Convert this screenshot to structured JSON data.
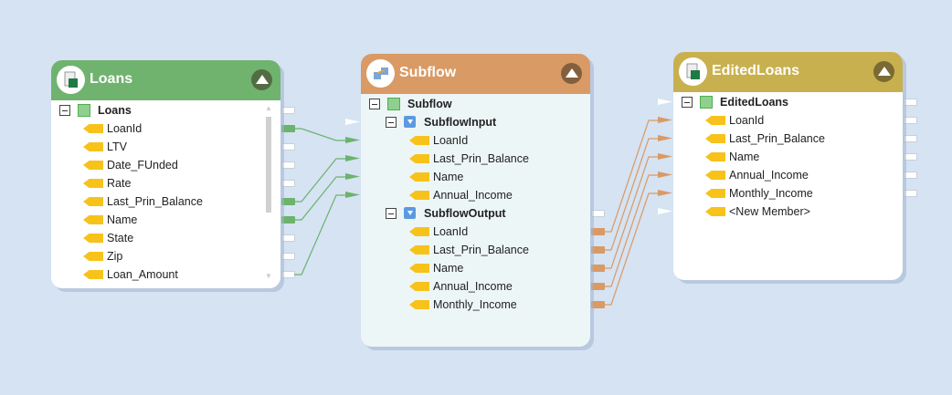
{
  "colors": {
    "background": "#d5e3f3",
    "loans_header": "#6fb36f",
    "subflow_header": "#d99a65",
    "edited_header": "#c8b04e",
    "green_link": "#6cb36c",
    "orange_link": "#d99a65"
  },
  "nodes": [
    {
      "id": "loans",
      "title": "Loans",
      "icon": "excel-file-icon",
      "header_color": "#6fb36f",
      "body_color": "#ffffff",
      "rows": [
        {
          "label": "Loans",
          "kind": "root",
          "level": 0,
          "out": "empty"
        },
        {
          "label": "LoanId",
          "kind": "field",
          "level": 1,
          "out": "green"
        },
        {
          "label": "LTV",
          "kind": "field",
          "level": 1,
          "out": "empty"
        },
        {
          "label": "Date_FUnded",
          "kind": "field",
          "level": 1,
          "out": "empty"
        },
        {
          "label": "Rate",
          "kind": "field",
          "level": 1,
          "out": "empty"
        },
        {
          "label": "Last_Prin_Balance",
          "kind": "field",
          "level": 1,
          "out": "green"
        },
        {
          "label": "Name",
          "kind": "field",
          "level": 1,
          "out": "green"
        },
        {
          "label": "State",
          "kind": "field",
          "level": 1,
          "out": "empty"
        },
        {
          "label": "Zip",
          "kind": "field",
          "level": 1,
          "out": "empty"
        },
        {
          "label": "Loan_Amount",
          "kind": "field",
          "level": 1,
          "out": "empty"
        }
      ]
    },
    {
      "id": "subflow",
      "title": "Subflow",
      "icon": "subflow-icon",
      "header_color": "#d99a65",
      "body_color": "#edf6f6",
      "rows": [
        {
          "label": "Subflow",
          "kind": "root",
          "level": 0
        },
        {
          "label": "SubflowInput",
          "kind": "group",
          "level": 1,
          "in": "empty"
        },
        {
          "label": "LoanId",
          "kind": "field",
          "level": 2,
          "in": "green"
        },
        {
          "label": "Last_Prin_Balance",
          "kind": "field",
          "level": 2,
          "in": "green"
        },
        {
          "label": "Name",
          "kind": "field",
          "level": 2,
          "in": "green"
        },
        {
          "label": "Annual_Income",
          "kind": "field",
          "level": 2,
          "in": "green"
        },
        {
          "label": "SubflowOutput",
          "kind": "group",
          "level": 1,
          "out": "empty"
        },
        {
          "label": "LoanId",
          "kind": "field",
          "level": 2,
          "out": "orange"
        },
        {
          "label": "Last_Prin_Balance",
          "kind": "field",
          "level": 2,
          "out": "orange"
        },
        {
          "label": "Name",
          "kind": "field",
          "level": 2,
          "out": "orange"
        },
        {
          "label": "Annual_Income",
          "kind": "field",
          "level": 2,
          "out": "orange"
        },
        {
          "label": "Monthly_Income",
          "kind": "field",
          "level": 2,
          "out": "orange"
        }
      ]
    },
    {
      "id": "edited",
      "title": "EditedLoans",
      "icon": "excel-file-icon",
      "header_color": "#c8b04e",
      "body_color": "#ffffff",
      "rows": [
        {
          "label": "EditedLoans",
          "kind": "root",
          "level": 0,
          "in": "empty",
          "out": "empty"
        },
        {
          "label": "LoanId",
          "kind": "field",
          "level": 1,
          "in": "orange",
          "out": "empty"
        },
        {
          "label": "Last_Prin_Balance",
          "kind": "field",
          "level": 1,
          "in": "orange",
          "out": "empty"
        },
        {
          "label": "Name",
          "kind": "field",
          "level": 1,
          "in": "orange",
          "out": "empty"
        },
        {
          "label": "Annual_Income",
          "kind": "field",
          "level": 1,
          "in": "orange",
          "out": "empty"
        },
        {
          "label": "Monthly_Income",
          "kind": "field",
          "level": 1,
          "in": "orange",
          "out": "empty"
        },
        {
          "label": "<New Member>",
          "kind": "field",
          "level": 1,
          "in": "empty"
        }
      ]
    }
  ],
  "connections": [
    {
      "from": "loans.1",
      "to": "subflow.2",
      "color": "green"
    },
    {
      "from": "loans.5",
      "to": "subflow.3",
      "color": "green"
    },
    {
      "from": "loans.6",
      "to": "subflow.4",
      "color": "green"
    },
    {
      "from": "loans.9",
      "to": "subflow.5",
      "color": "green"
    },
    {
      "from": "subflow.7",
      "to": "edited.1",
      "color": "orange"
    },
    {
      "from": "subflow.8",
      "to": "edited.2",
      "color": "orange"
    },
    {
      "from": "subflow.9",
      "to": "edited.3",
      "color": "orange"
    },
    {
      "from": "subflow.10",
      "to": "edited.4",
      "color": "orange"
    },
    {
      "from": "subflow.11",
      "to": "edited.5",
      "color": "orange"
    }
  ]
}
